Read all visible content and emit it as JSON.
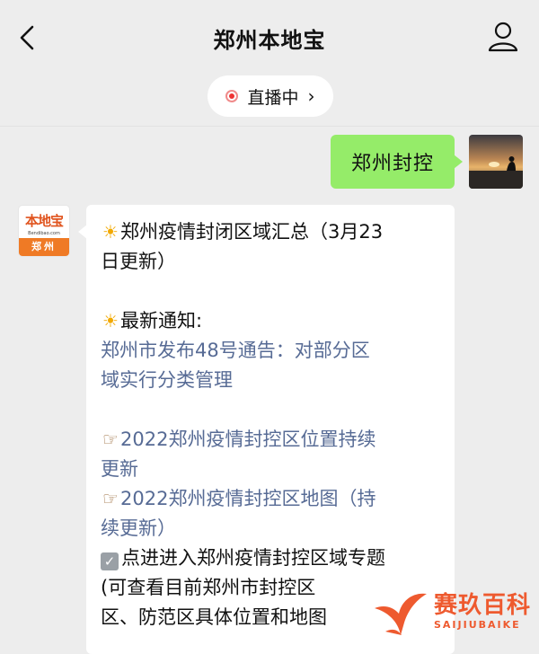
{
  "header": {
    "title": "郑州本地宝",
    "back_icon": "chevron-left-icon",
    "profile_icon": "person-icon"
  },
  "live": {
    "label": "直播中",
    "arrow": "›"
  },
  "chat": {
    "user_message": "郑州封控",
    "bot": {
      "avatar_logo": "本地宝",
      "avatar_sub": "Bendibao.com",
      "avatar_city": "郑州",
      "lines": [
        "郑州疫情封闭区域汇总（3月23",
        "日更新）",
        "最新通知:",
        "郑州市发布48号通告：对部分区",
        "域实行分类管理",
        "2022郑州疫情封控区位置持续",
        "更新",
        "2022郑州疫情封控区地图（持",
        "续更新）",
        "点进进入郑州疫情封控区域专题",
        "(可查看目前郑州市封控区",
        "区、防范区具体位置和地图"
      ]
    }
  },
  "watermark": {
    "cn": "赛玖百科",
    "en": "SAIJIUBAIKE"
  },
  "colors": {
    "background": "#ededed",
    "user_bubble": "#95ec69",
    "link": "#576b95",
    "brand_orange": "#ef7a25"
  }
}
